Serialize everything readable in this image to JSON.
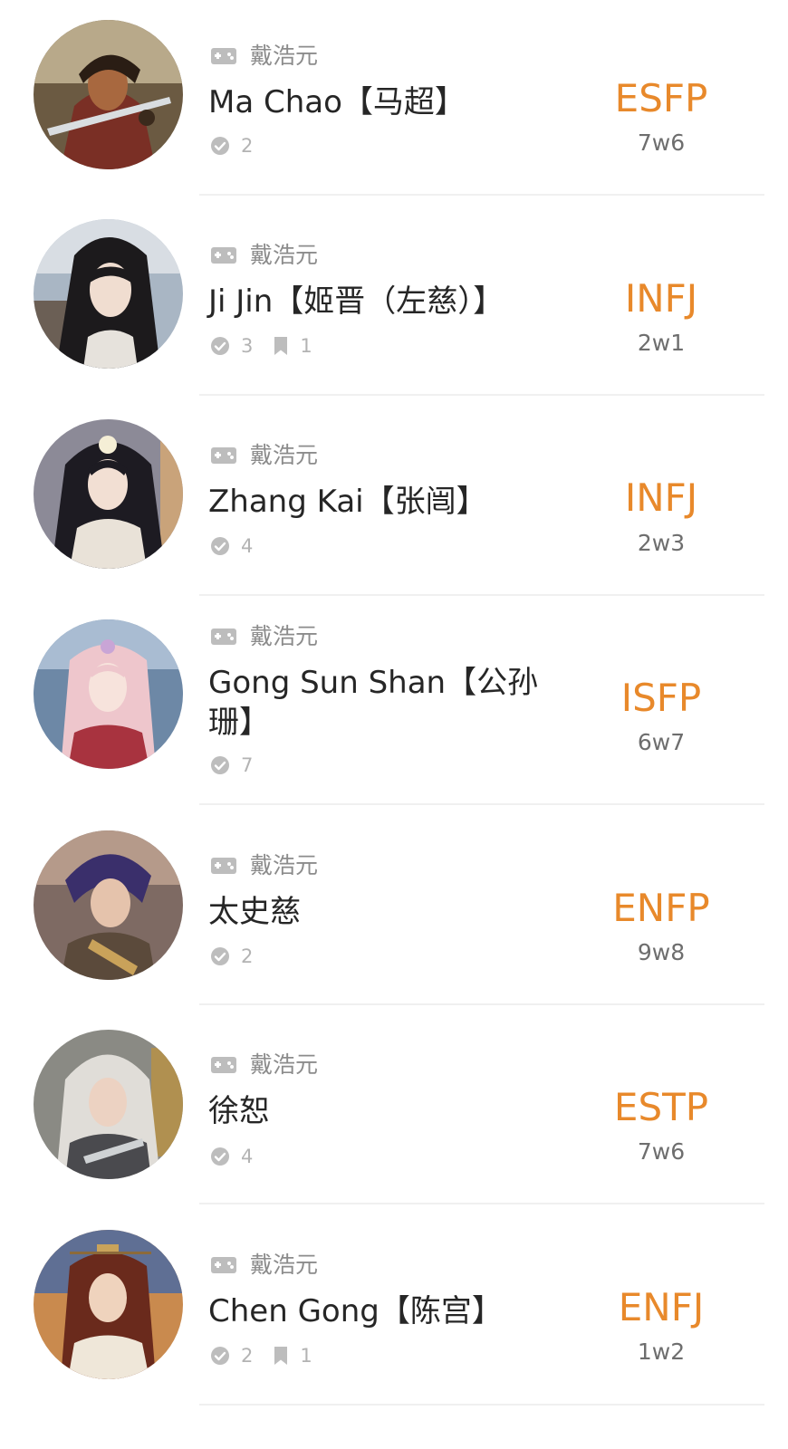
{
  "colors": {
    "mbti_accent": "#e8892b",
    "source_text": "#8c8c8c",
    "stat_text": "#b3b3b3",
    "icon_gray": "#bdbdbd",
    "divider": "#f0f0f0"
  },
  "icons": {
    "source": "gamepad-icon",
    "votes": "check-circle-icon",
    "comments": "bookmark-icon"
  },
  "profiles": [
    {
      "source": "戴浩元",
      "name": "Ma Chao【马超】",
      "votes": "2",
      "comments": "",
      "mbti": "ESFP",
      "enneagram": "7w6"
    },
    {
      "source": "戴浩元",
      "name": "Ji Jin【姬晋（左慈）】",
      "votes": "3",
      "comments": "1",
      "mbti": "INFJ",
      "enneagram": "2w1"
    },
    {
      "source": "戴浩元",
      "name": "Zhang Kai【张闿】",
      "votes": "4",
      "comments": "",
      "mbti": "INFJ",
      "enneagram": "2w3"
    },
    {
      "source": "戴浩元",
      "name": "Gong Sun Shan【公孙珊】",
      "votes": "7",
      "comments": "",
      "mbti": "ISFP",
      "enneagram": "6w7"
    },
    {
      "source": "戴浩元",
      "name": "太史慈",
      "votes": "2",
      "comments": "",
      "mbti": "ENFP",
      "enneagram": "9w8"
    },
    {
      "source": "戴浩元",
      "name": "徐恕",
      "votes": "4",
      "comments": "",
      "mbti": "ESTP",
      "enneagram": "7w6"
    },
    {
      "source": "戴浩元",
      "name": "Chen Gong【陈宫】",
      "votes": "2",
      "comments": "1",
      "mbti": "ENFJ",
      "enneagram": "1w2"
    }
  ]
}
